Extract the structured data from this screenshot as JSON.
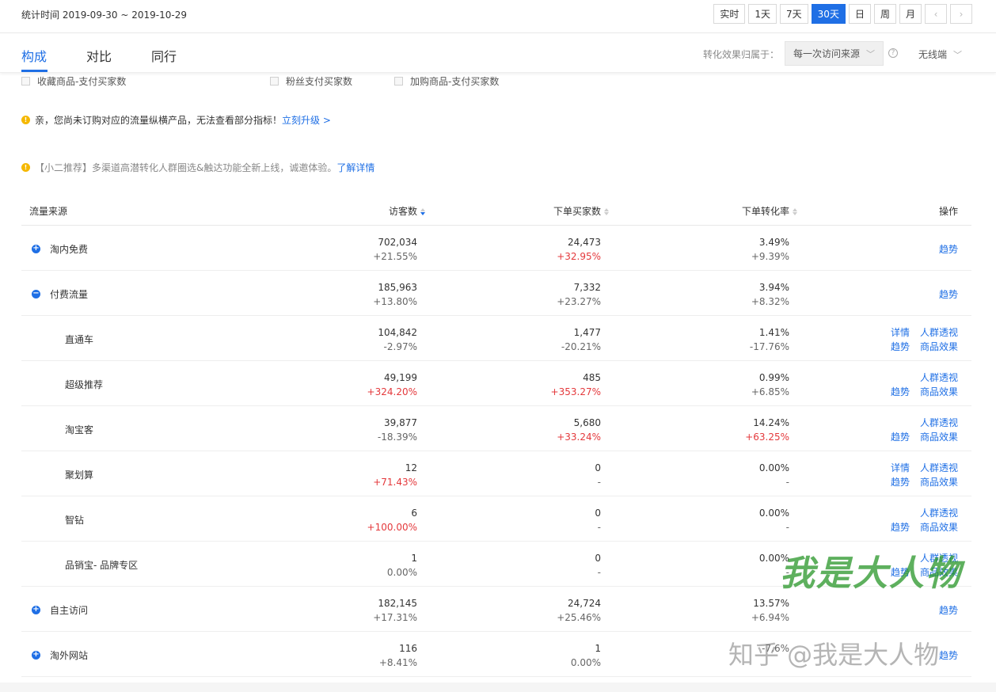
{
  "header": {
    "date_range": "统计时间 2019-09-30 ~ 2019-10-29",
    "periods": [
      "实时",
      "1天",
      "7天",
      "30天",
      "日",
      "周",
      "月"
    ],
    "active_period": "30天",
    "prev_icon": "chevron-left-icon",
    "next_icon": "chevron-right-icon"
  },
  "tabs": {
    "items": [
      "构成",
      "对比",
      "同行"
    ],
    "active": "构成",
    "attribution_label": "转化效果归属于：",
    "attribution_value": "每一次访问来源",
    "device_value": "无线端"
  },
  "checkboxes": [
    "收藏商品-支付买家数",
    "粉丝支付买家数",
    "加购商品-支付买家数"
  ],
  "notices": {
    "upgrade_text": "亲，您尚未订购对应的流量纵横产品，无法查看部分指标！",
    "upgrade_link": "立刻升级 >",
    "promo_text": "【小二推荐】多渠道高潜转化人群圈选&触达功能全新上线，诚邀体验。",
    "promo_link": "了解详情"
  },
  "table": {
    "headers": {
      "source": "流量来源",
      "visitors": "访客数",
      "buyers": "下单买家数",
      "rate": "下单转化率",
      "ops": "操作"
    },
    "rows": [
      {
        "name": "淘内免费",
        "icon": "plus",
        "visitors": "702,034",
        "visitors_change": "+21.55%",
        "visitors_up": false,
        "buyers": "24,473",
        "buyers_change": "+32.95%",
        "buyers_up": true,
        "rate": "3.49%",
        "rate_change": "+9.39%",
        "rate_up": false,
        "ops": [
          "趋势"
        ]
      },
      {
        "name": "付费流量",
        "icon": "minus",
        "visitors": "185,963",
        "visitors_change": "+13.80%",
        "visitors_up": false,
        "buyers": "7,332",
        "buyers_change": "+23.27%",
        "buyers_up": false,
        "rate": "3.94%",
        "rate_change": "+8.32%",
        "rate_up": false,
        "ops": [
          "趋势"
        ]
      },
      {
        "name": "直通车",
        "icon": "",
        "visitors": "104,842",
        "visitors_change": "-2.97%",
        "visitors_up": false,
        "buyers": "1,477",
        "buyers_change": "-20.21%",
        "buyers_up": false,
        "rate": "1.41%",
        "rate_change": "-17.76%",
        "rate_up": false,
        "ops": [
          "详情",
          "人群透视",
          "趋势",
          "商品效果"
        ]
      },
      {
        "name": "超级推荐",
        "icon": "",
        "visitors": "49,199",
        "visitors_change": "+324.20%",
        "visitors_up": true,
        "buyers": "485",
        "buyers_change": "+353.27%",
        "buyers_up": true,
        "rate": "0.99%",
        "rate_change": "+6.85%",
        "rate_up": false,
        "ops": [
          "",
          "人群透视",
          "趋势",
          "商品效果"
        ]
      },
      {
        "name": "淘宝客",
        "icon": "",
        "visitors": "39,877",
        "visitors_change": "-18.39%",
        "visitors_up": false,
        "buyers": "5,680",
        "buyers_change": "+33.24%",
        "buyers_up": true,
        "rate": "14.24%",
        "rate_change": "+63.25%",
        "rate_up": true,
        "ops": [
          "",
          "人群透视",
          "趋势",
          "商品效果"
        ]
      },
      {
        "name": "聚划算",
        "icon": "",
        "visitors": "12",
        "visitors_change": "+71.43%",
        "visitors_up": true,
        "buyers": "0",
        "buyers_change": "-",
        "buyers_up": false,
        "rate": "0.00%",
        "rate_change": "-",
        "rate_up": false,
        "ops": [
          "详情",
          "人群透视",
          "趋势",
          "商品效果"
        ]
      },
      {
        "name": "智钻",
        "icon": "",
        "visitors": "6",
        "visitors_change": "+100.00%",
        "visitors_up": true,
        "buyers": "0",
        "buyers_change": "-",
        "buyers_up": false,
        "rate": "0.00%",
        "rate_change": "-",
        "rate_up": false,
        "ops": [
          "",
          "人群透视",
          "趋势",
          "商品效果"
        ]
      },
      {
        "name": "品销宝- 品牌专区",
        "icon": "",
        "visitors": "1",
        "visitors_change": "0.00%",
        "visitors_up": false,
        "buyers": "0",
        "buyers_change": "-",
        "buyers_up": false,
        "rate": "0.00%",
        "rate_change": "-",
        "rate_up": false,
        "ops": [
          "",
          "人群透视",
          "趋势",
          "商品效果"
        ]
      },
      {
        "name": "自主访问",
        "icon": "plus",
        "visitors": "182,145",
        "visitors_change": "+17.31%",
        "visitors_up": false,
        "buyers": "24,724",
        "buyers_change": "+25.46%",
        "buyers_up": false,
        "rate": "13.57%",
        "rate_change": "+6.94%",
        "rate_up": false,
        "ops": [
          "趋势"
        ]
      },
      {
        "name": "淘外网站",
        "icon": "plus",
        "visitors": "116",
        "visitors_change": "+8.41%",
        "visitors_up": false,
        "buyers": "1",
        "buyers_change": "0.00%",
        "buyers_up": false,
        "rate": "",
        "rate_change": "-7.6%",
        "rate_up": false,
        "ops": [
          "趋势"
        ]
      }
    ]
  },
  "watermarks": {
    "calligraphy": "我是大人物",
    "zhihu": "知乎 @我是大人物"
  },
  "colors": {
    "accent": "#1f6fe5",
    "increase": "#e4393c",
    "warning": "#f5b800"
  }
}
